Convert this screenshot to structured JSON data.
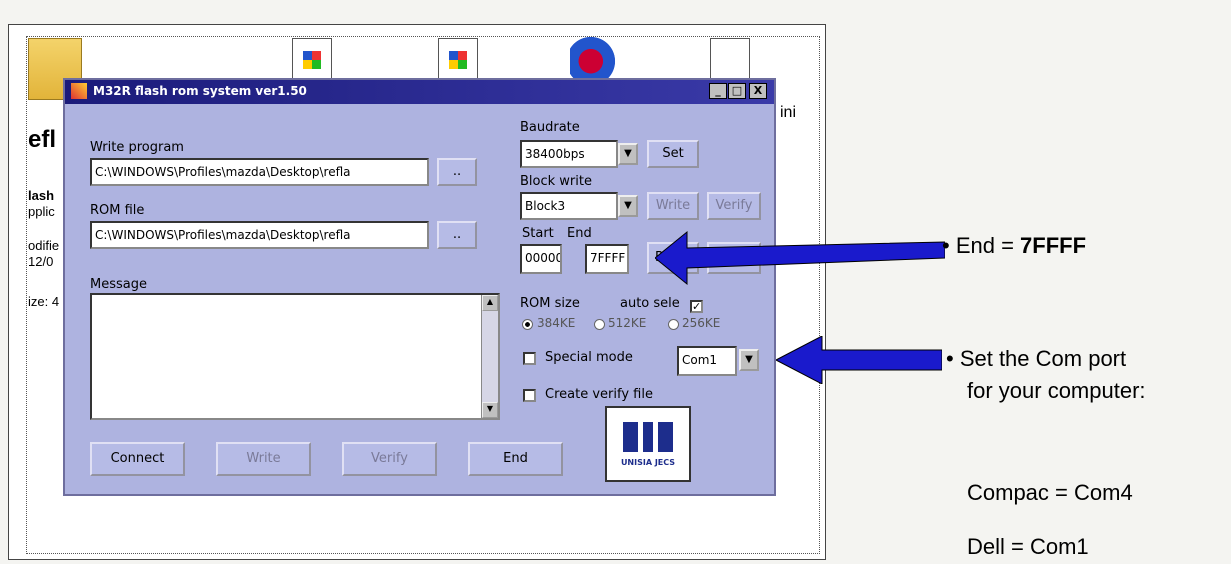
{
  "window": {
    "title": "M32R flash rom system ver1.50",
    "buttons": [
      "_",
      "□",
      "X"
    ]
  },
  "desktop": {
    "side_text": [
      "efl",
      "lash",
      "pplic",
      "odifie",
      "12/0",
      "ize: 4"
    ],
    "ini_label": "ini"
  },
  "form": {
    "write_program_label": "Write program",
    "write_program_value": "C:\\WINDOWS\\Profiles\\mazda\\Desktop\\refla",
    "rom_file_label": "ROM file",
    "rom_file_value": "C:\\WINDOWS\\Profiles\\mazda\\Desktop\\refla",
    "browse_label": "..",
    "message_label": "Message",
    "baudrate_label": "Baudrate",
    "baudrate_value": "38400bps",
    "set_label": "Set",
    "block_write_label": "Block write",
    "block_value": "Block3",
    "write_label": "Write",
    "verify_label": "Verify",
    "start_label": "Start",
    "end_label": "End",
    "start_value": "00000",
    "end_value": "7FFFF",
    "read_label": "Re",
    "rom_size_label": "ROM size",
    "auto_select_label": "auto sele",
    "rom_options": [
      "384KE",
      "512KE",
      "256KE"
    ],
    "special_mode_label": "Special mode",
    "com_value": "Com1",
    "create_verify_label": "Create verify file",
    "logo_caption": "UNISIA JECS",
    "connect_label": "Connect",
    "write_bottom_label": "Write",
    "verify_bottom_label": "Verify",
    "end_bottom_label": "End"
  },
  "annotations": {
    "note1_prefix": "• End = ",
    "note1_value": "7FFFF",
    "note2_line1": "• Set the Com port",
    "note2_line2": "for your computer:",
    "note3": "Compac = Com4",
    "note4": "Dell = Com1"
  },
  "colors": {
    "window_bg": "#aeb3e0",
    "title_bar": "#1b1b7a",
    "arrow": "#1a1acc"
  }
}
